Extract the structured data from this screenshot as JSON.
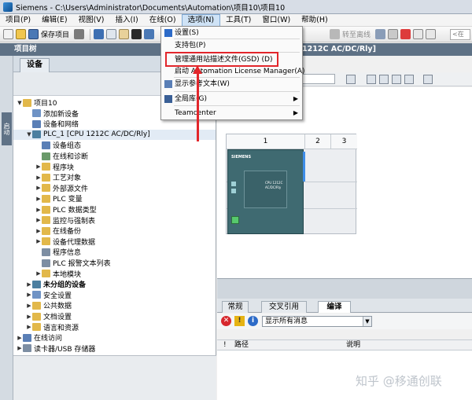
{
  "window": {
    "title": "Siemens  -  C:\\Users\\Administrator\\Documents\\Automation\\项目10\\项目10"
  },
  "menubar": {
    "items": [
      "项目(P)",
      "编辑(E)",
      "视图(V)",
      "插入(I)",
      "在线(O)",
      "选项(N)",
      "工具(T)",
      "窗口(W)",
      "帮助(H)"
    ],
    "active_index": 5
  },
  "toolbar": {
    "save_label": "保存项目",
    "go_offline_label": "转至离线",
    "search_placeholder": "<在"
  },
  "options_menu": {
    "items": [
      {
        "label": "设置(S)",
        "icon": "settings-icon",
        "submenu": false
      },
      {
        "label": "支持包(P)",
        "icon": "",
        "submenu": false
      },
      {
        "label": "管理通用站描述文件(GSD) (D)",
        "icon": "",
        "submenu": false,
        "highlighted": true
      },
      {
        "label": "启动 Automation License Manager(A)",
        "icon": "",
        "submenu": false
      },
      {
        "label": "显示参考文本(W)",
        "icon": "reference-text-icon",
        "submenu": false
      },
      {
        "label": "全局库(G)",
        "icon": "library-icon",
        "submenu": true
      },
      {
        "label": "Teamcenter",
        "icon": "",
        "submenu": true
      }
    ]
  },
  "project_tree": {
    "header": "项目树",
    "tab": "设备",
    "side_tab": "启动",
    "items": [
      {
        "label": "项目10",
        "indent": 0,
        "arrow": "▼",
        "icon_color": "#e2b84a"
      },
      {
        "label": "添加新设备",
        "indent": 1,
        "arrow": "",
        "icon_color": "#6f93c5"
      },
      {
        "label": "设备和网络",
        "indent": 1,
        "arrow": "",
        "icon_color": "#5a7fb6"
      },
      {
        "label": "PLC_1 [CPU 1212C AC/DC/Rly]",
        "indent": 1,
        "arrow": "▼",
        "icon_color": "#4b7fa0",
        "selected": true
      },
      {
        "label": "设备组态",
        "indent": 2,
        "arrow": "",
        "icon_color": "#5a7fb6"
      },
      {
        "label": "在线和诊断",
        "indent": 2,
        "arrow": "",
        "icon_color": "#6a9a6a"
      },
      {
        "label": "程序块",
        "indent": 2,
        "arrow": "▶",
        "icon_color": "#e2b84a"
      },
      {
        "label": "工艺对象",
        "indent": 2,
        "arrow": "▶",
        "icon_color": "#e2b84a"
      },
      {
        "label": "外部源文件",
        "indent": 2,
        "arrow": "▶",
        "icon_color": "#e2b84a"
      },
      {
        "label": "PLC 变量",
        "indent": 2,
        "arrow": "▶",
        "icon_color": "#e2b84a"
      },
      {
        "label": "PLC 数据类型",
        "indent": 2,
        "arrow": "▶",
        "icon_color": "#e2b84a"
      },
      {
        "label": "监控与强制表",
        "indent": 2,
        "arrow": "▶",
        "icon_color": "#e2b84a"
      },
      {
        "label": "在线备份",
        "indent": 2,
        "arrow": "▶",
        "icon_color": "#e2b84a"
      },
      {
        "label": "设备代理数据",
        "indent": 2,
        "arrow": "▶",
        "icon_color": "#e2b84a"
      },
      {
        "label": "程序信息",
        "indent": 2,
        "arrow": "",
        "icon_color": "#7d8ea3"
      },
      {
        "label": "PLC 报警文本列表",
        "indent": 2,
        "arrow": "",
        "icon_color": "#7d8ea3"
      },
      {
        "label": "本地模块",
        "indent": 2,
        "arrow": "▶",
        "icon_color": "#e2b84a"
      },
      {
        "label": "未分组的设备",
        "indent": 1,
        "arrow": "▶",
        "icon_color": "#4b7fa0",
        "bold": true
      },
      {
        "label": "安全设置",
        "indent": 1,
        "arrow": "▶",
        "icon_color": "#6f93c5"
      },
      {
        "label": "公共数据",
        "indent": 1,
        "arrow": "▶",
        "icon_color": "#e2b84a"
      },
      {
        "label": "文档设置",
        "indent": 1,
        "arrow": "▶",
        "icon_color": "#e2b84a"
      },
      {
        "label": "语言和资源",
        "indent": 1,
        "arrow": "▶",
        "icon_color": "#e2b84a"
      },
      {
        "label": "在线访问",
        "indent": 0,
        "arrow": "▶",
        "icon_color": "#5a7fb6"
      },
      {
        "label": "读卡器/USB 存储器",
        "indent": 0,
        "arrow": "▶",
        "icon_color": "#7d8ea3"
      }
    ]
  },
  "device_view": {
    "device_label": "1212C AC/DC/Rly]",
    "slots": [
      "1",
      "2",
      "3"
    ],
    "brand": "SIEMENS",
    "model_code": "CPU 1212C",
    "model_sub": "AC/DC/Rly"
  },
  "inspector": {
    "tabs": [
      "常规",
      "交叉引用",
      "编译"
    ],
    "active_tab": 2,
    "filter_label": "显示所有消息",
    "col_path": "路径",
    "col_desc": "说明",
    "col_bang": "!"
  },
  "watermark": "知乎 @移通创联",
  "colors": {
    "accent": "#5e7185",
    "highlight": "#e2262b",
    "selection": "#e2ebf5"
  }
}
